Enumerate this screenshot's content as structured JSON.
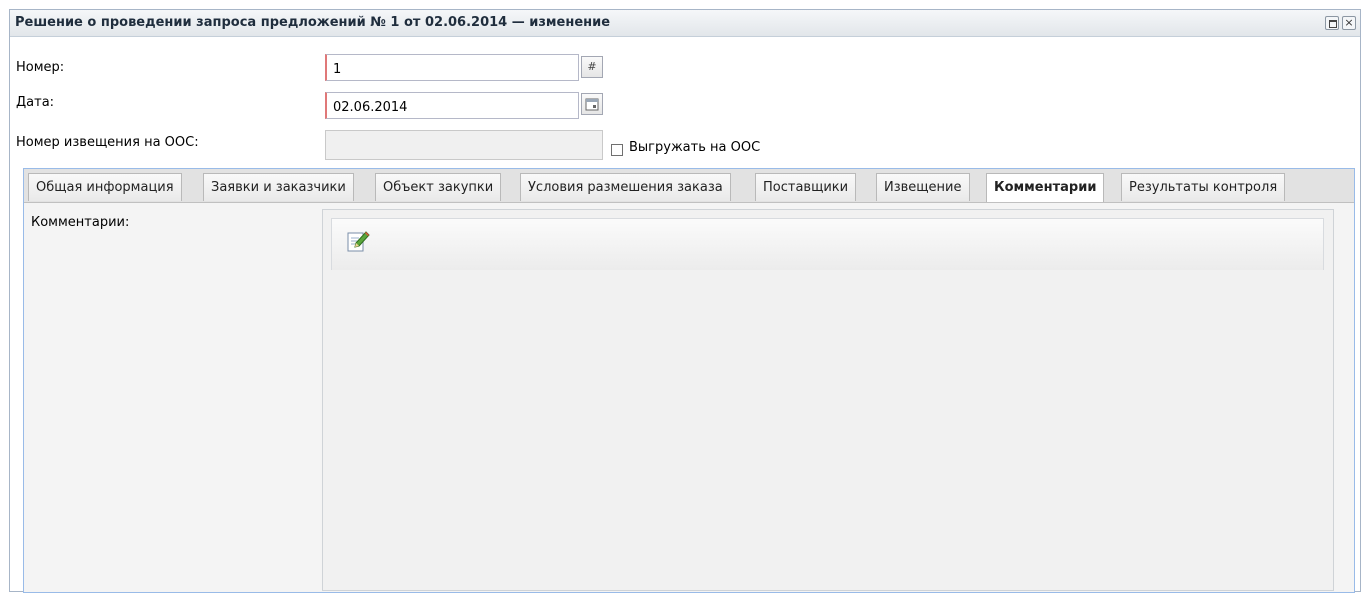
{
  "window": {
    "title": "Решение о проведении запроса предложений № 1 от 02.06.2014 — изменение",
    "maximize_icon": "window-maximize-icon",
    "close_icon": "close-icon",
    "close_glyph": "×"
  },
  "form": {
    "number_label": "Номер:",
    "number_value": "1",
    "date_label": "Дата:",
    "date_value": "02.06.2014",
    "notice_label": "Номер извещения на ООС:",
    "notice_value": "",
    "upload_checkbox_label": "Выгружать на ООС",
    "upload_checked": false,
    "number_trigger_glyph": "#"
  },
  "tabs": [
    {
      "label": "Общая информация",
      "active": false
    },
    {
      "label": "Заявки и заказчики",
      "active": false
    },
    {
      "label": "Объект закупки",
      "active": false
    },
    {
      "label": "Условия размешения заказа",
      "active": false
    },
    {
      "label": "Поставщики",
      "active": false
    },
    {
      "label": "Извещение",
      "active": false
    },
    {
      "label": "Комментарии",
      "active": true
    },
    {
      "label": "Результаты контроля",
      "active": false
    }
  ],
  "comments": {
    "label": "Комментарии:",
    "toolbar_icon": "edit-note-icon"
  },
  "colors": {
    "required_border": "#e07878",
    "tab_border": "#99bbe8"
  }
}
